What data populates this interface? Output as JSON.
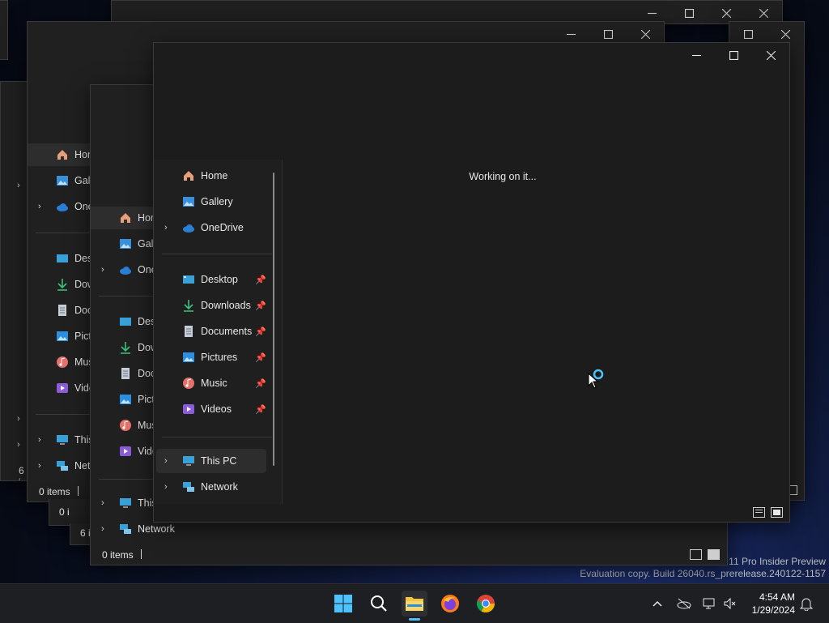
{
  "desktop": {
    "watermark_line1": "11 Pro Insider Preview",
    "watermark_line2": "Evaluation copy. Build 26040.rs_prerelease.240122-1157"
  },
  "back_window_1": {
    "nav": [
      "Hom",
      "Galle",
      "One",
      "Desk",
      "Dow",
      "Docu",
      "Pictu",
      "Musi",
      "Vide",
      "This",
      "Netw"
    ],
    "status": "0 items"
  },
  "back_window_2": {
    "nav": [
      "Hon",
      "Galle",
      "One",
      "Desk",
      "Dow",
      "Docu",
      "Pictu",
      "Musi",
      "Vide",
      "This",
      "Network"
    ],
    "status": "0 items"
  },
  "back_fragments": {
    "status_a": "0 i",
    "status_b": "6 i",
    "status_c": "6 i"
  },
  "front_window": {
    "working_text": "Working on it...",
    "nav": {
      "home": "Home",
      "gallery": "Gallery",
      "onedrive": "OneDrive",
      "desktop": "Desktop",
      "downloads": "Downloads",
      "documents": "Documents",
      "pictures": "Pictures",
      "music": "Music",
      "videos": "Videos",
      "thispc": "This PC",
      "network": "Network"
    }
  },
  "taskbar": {
    "time": "4:54 AM",
    "date": "1/29/2024"
  },
  "colors": {
    "accent": "#4cc2ff",
    "folder_yellow": "#f4c542",
    "window_bg": "#1c1c1c"
  },
  "icons": {
    "start": "windows-start-icon",
    "search": "search-icon",
    "explorer": "file-explorer-icon",
    "firefox": "firefox-icon",
    "chrome": "chrome-icon"
  }
}
